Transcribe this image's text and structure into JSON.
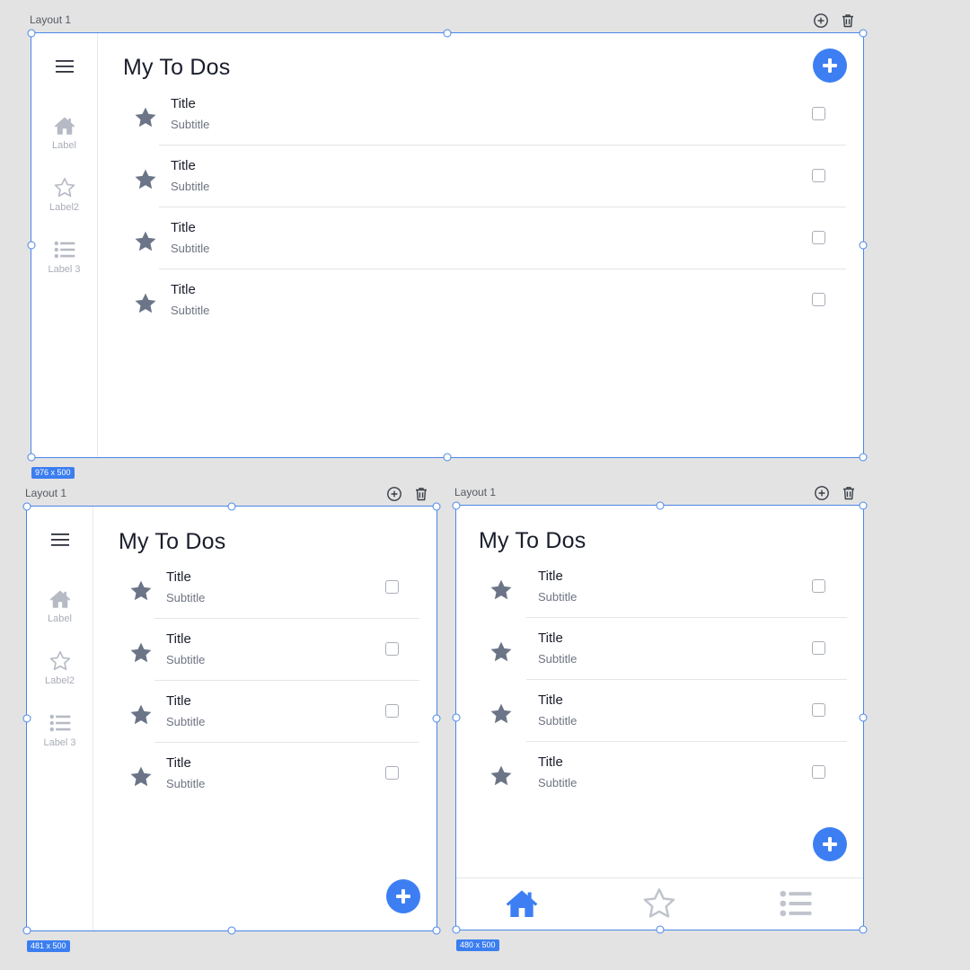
{
  "colors": {
    "accent": "#3d7ff3",
    "frame_border": "#4a86ea",
    "star": "#6b7587",
    "rail_icon": "#b5bac4",
    "bottom_icon_inactive": "#c0c4cc"
  },
  "frames": [
    {
      "label": "Layout 1",
      "size_badge": "976 x 500",
      "title": "My To Dos",
      "rail": {
        "items": [
          {
            "icon": "home-icon",
            "label": "Label"
          },
          {
            "icon": "star-outline-icon",
            "label": "Label2"
          },
          {
            "icon": "list-icon",
            "label": "Label 3"
          }
        ]
      },
      "items": [
        {
          "title": "Title",
          "subtitle": "Subtitle"
        },
        {
          "title": "Title",
          "subtitle": "Subtitle"
        },
        {
          "title": "Title",
          "subtitle": "Subtitle"
        },
        {
          "title": "Title",
          "subtitle": "Subtitle"
        }
      ]
    },
    {
      "label": "Layout 1",
      "size_badge": "481 x 500",
      "title": "My To Dos",
      "rail": {
        "items": [
          {
            "icon": "home-icon",
            "label": "Label"
          },
          {
            "icon": "star-outline-icon",
            "label": "Label2"
          },
          {
            "icon": "list-icon",
            "label": "Label 3"
          }
        ]
      },
      "items": [
        {
          "title": "Title",
          "subtitle": "Subtitle"
        },
        {
          "title": "Title",
          "subtitle": "Subtitle"
        },
        {
          "title": "Title",
          "subtitle": "Subtitle"
        },
        {
          "title": "Title",
          "subtitle": "Subtitle"
        }
      ]
    },
    {
      "label": "Layout 1",
      "size_badge": "480 x 500",
      "title": "My To Dos",
      "bottom_nav": [
        "home-icon",
        "star-outline-icon",
        "list-icon"
      ],
      "items": [
        {
          "title": "Title",
          "subtitle": "Subtitle"
        },
        {
          "title": "Title",
          "subtitle": "Subtitle"
        },
        {
          "title": "Title",
          "subtitle": "Subtitle"
        },
        {
          "title": "Title",
          "subtitle": "Subtitle"
        }
      ]
    }
  ]
}
